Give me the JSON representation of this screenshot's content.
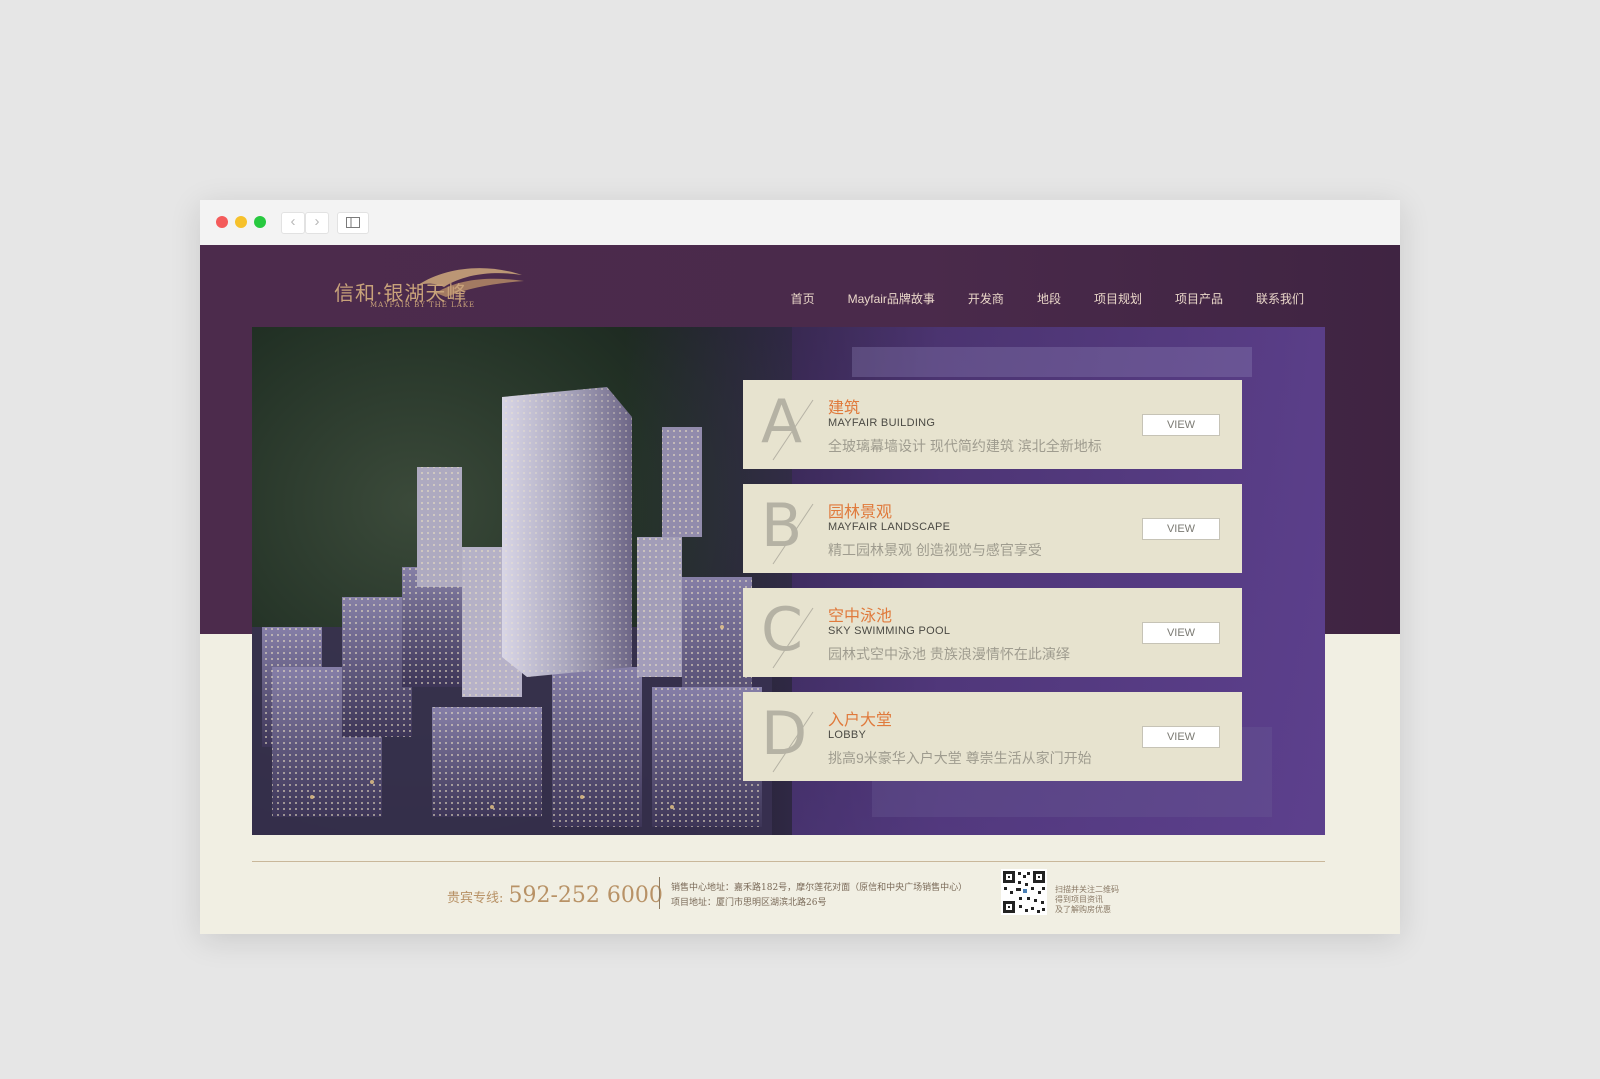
{
  "window": {
    "controls": [
      "close",
      "minimize",
      "maximize"
    ],
    "back_glyph": "‹",
    "forward_glyph": "›",
    "icons": {
      "sidebar": "sidebar-icon"
    }
  },
  "header": {
    "logo_cn": "信和·银湖天峰",
    "logo_en": "MAYFAIR BY THE LAKE",
    "nav": [
      "首页",
      "Mayfair品牌故事",
      "开发商",
      "地段",
      "项目规划",
      "项目产品",
      "联系我们"
    ]
  },
  "features": [
    {
      "letter": "A",
      "title": "建筑",
      "subtitle": "MAYFAIR BUILDING",
      "desc": "全玻璃幕墙设计 现代简约建筑 滨北全新地标",
      "button": "VIEW"
    },
    {
      "letter": "B",
      "title": "园林景观",
      "subtitle": "MAYFAIR LANDSCAPE",
      "desc": "精工园林景观 创造视觉与感官享受",
      "button": "VIEW"
    },
    {
      "letter": "C",
      "title": "空中泳池",
      "subtitle": "SKY SWIMMING POOL",
      "desc": "园林式空中泳池 贵族浪漫情怀在此演绎",
      "button": "VIEW"
    },
    {
      "letter": "D",
      "title": "入户大堂",
      "subtitle": "LOBBY",
      "desc": "挑高9米豪华入户大堂 尊崇生活从家门开始",
      "button": "VIEW"
    }
  ],
  "footer": {
    "hotline_label": "贵宾专线:",
    "hotline_number": "592-252 6000",
    "address_sales": "销售中心地址：嘉禾路182号，摩尔莲花对面（原信和中央广场销售中心）",
    "address_project": "项目地址：厦门市思明区湖滨北路26号",
    "qr_note": [
      "扫描并关注二维码",
      "得到项目资讯",
      "及了解购房优惠"
    ]
  },
  "colors": {
    "header_bg": "#4a2a4b",
    "accent_title": "#e07a3c",
    "gold": "#c8a27a",
    "card_bg": "#e7e3cf",
    "page_bg": "#f1efe3"
  }
}
